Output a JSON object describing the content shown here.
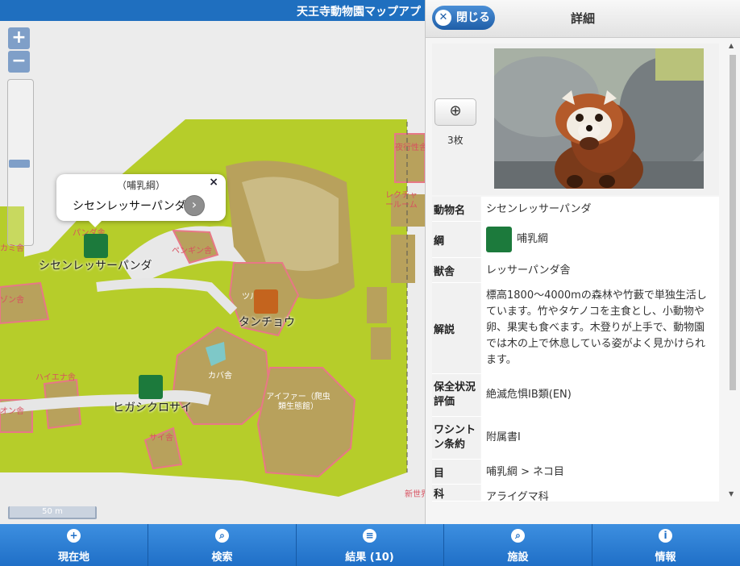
{
  "app": {
    "title": "天王寺動物園マップアプ"
  },
  "map": {
    "zoom_in": "+",
    "zoom_out": "−",
    "scale_label": "50 m",
    "popup": {
      "class_label": "（哺乳綱）",
      "animal_name": "シセンレッサーパンダ",
      "close": "×",
      "go": "›"
    },
    "place_labels": [
      "夜行性舎",
      "レクチャールーム",
      "ペンギン舎",
      "ツル舎",
      "カバ舎",
      "アイファー（爬虫類生態館）",
      "ハイエナ舎",
      "サイ舎",
      "パンダ舎",
      "カミ舎",
      "ゾン舎",
      "オン舎",
      "新世界"
    ],
    "animal_labels": [
      "シセンレッサーパンダ",
      "タンチョウ",
      "ヒガシクロサイ"
    ]
  },
  "panel": {
    "close_label": "閉じる",
    "title": "詳細",
    "photo_count": "3枚",
    "rows": [
      {
        "key": "動物名",
        "value": "シセンレッサーパンダ"
      },
      {
        "key": "綱",
        "value": "哺乳綱"
      },
      {
        "key": "獣舎",
        "value": "レッサーパンダ舎"
      },
      {
        "key": "解説",
        "value": "標高1800～4000mの森林や竹藪で単独生活しています。竹やタケノコを主食とし、小動物や卵、果実も食べます。木登りが上手で、動物園では木の上で休息している姿がよく見かけられます。"
      },
      {
        "key": "保全状況評価",
        "value": "絶滅危惧ⅠB類(EN)"
      },
      {
        "key": "ワシントン条約",
        "value": "附属書Ⅰ"
      },
      {
        "key": "目",
        "value": "哺乳綱 > ネコ目"
      },
      {
        "key": "科",
        "value": "アライグマ科"
      }
    ]
  },
  "navbar": {
    "items": [
      {
        "label": "現在地",
        "icon": "plus-icon"
      },
      {
        "label": "検索",
        "icon": "search-icon"
      },
      {
        "label": "結果 (10)",
        "icon": "list-icon"
      },
      {
        "label": "施設",
        "icon": "search-icon"
      },
      {
        "label": "情報",
        "icon": "info-icon"
      }
    ]
  },
  "colors": {
    "header": "#1f6fbf",
    "navbar": "#2f80d6",
    "lawn": "#b6cd2a",
    "building": "#b8a15c",
    "outline": "#e77886"
  }
}
